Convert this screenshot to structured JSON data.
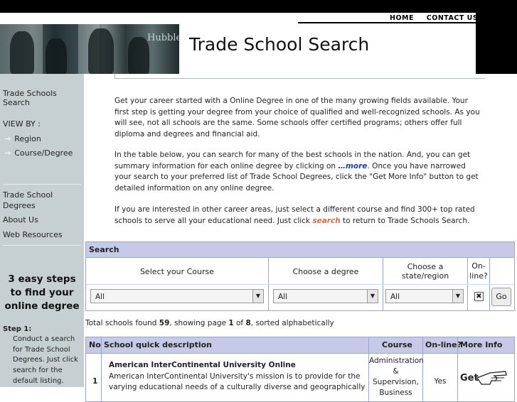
{
  "header": {
    "nav": [
      {
        "label": "HOME"
      },
      {
        "label": "CONTACT US"
      }
    ],
    "banner_text": "Hubble",
    "title": "Trade School Search"
  },
  "sidebar": {
    "top_link": "Trade Schools Search",
    "view_by": "VIEW BY :",
    "view_items": [
      {
        "label": "Region"
      },
      {
        "label": "Course/Degree"
      }
    ],
    "links": [
      {
        "label": "Trade School Degrees"
      },
      {
        "label": "About Us"
      },
      {
        "label": "Web Resources"
      }
    ],
    "steps_title": "3 easy steps to find your online degree",
    "step_label": "Step 1:",
    "step_text": "Conduct a search for Trade School Degrees. Just click search for the default listing."
  },
  "intro": {
    "p1": "Get your career started with a Online Degree in one of the many growing fields available. Your first step is getting your degree from your choice of qualified and well-recognized schools. As you will see, not all schools are the same. Some schools offer certified programs; others offer full diploma and degrees and financial aid.",
    "p2_before": "In the table below, you can search for many of the best schools in the nation. And, you can get summary information for each online degree by clicking on ",
    "p2_more": "…more",
    "p2_after": ". Once you have narrowed your search to your preferred list of Trade School Degrees, click the \"Get More Info\" button to get detailed information on any online degree.",
    "p3_before": "If you are interested in other career areas, just select a different course and find 300+ top rated schools to serve all your educational need. Just click ",
    "p3_link": "search",
    "p3_after": " to return to Trade Schools Search."
  },
  "search": {
    "heading": "Search",
    "labels": {
      "course": "Select your Course",
      "degree": "Choose a degree",
      "state": "Choose a state/region",
      "online": "On-line?"
    },
    "values": {
      "course": "All",
      "degree": "All",
      "state": "All",
      "online_mark": "✖"
    },
    "go_label": "Go"
  },
  "results": {
    "prefix": "Total schools found ",
    "total": "59",
    "mid1": ", showing page ",
    "page": "1",
    "mid2": " of ",
    "pages": "8",
    "suffix": ", sorted alphabetically"
  },
  "table": {
    "headers": {
      "no": "No",
      "desc": "School quick description",
      "course": "Course",
      "online": "On-line?",
      "info": "More Info"
    },
    "rows": [
      {
        "no": "1",
        "name": "American InterContinental University Online",
        "desc": "American InterContinental University's mission is to provide for the varying educational needs of a culturally diverse and geographically",
        "course": "Administration & Supervision, Business",
        "online": "Yes",
        "info_label": "Get"
      }
    ]
  }
}
